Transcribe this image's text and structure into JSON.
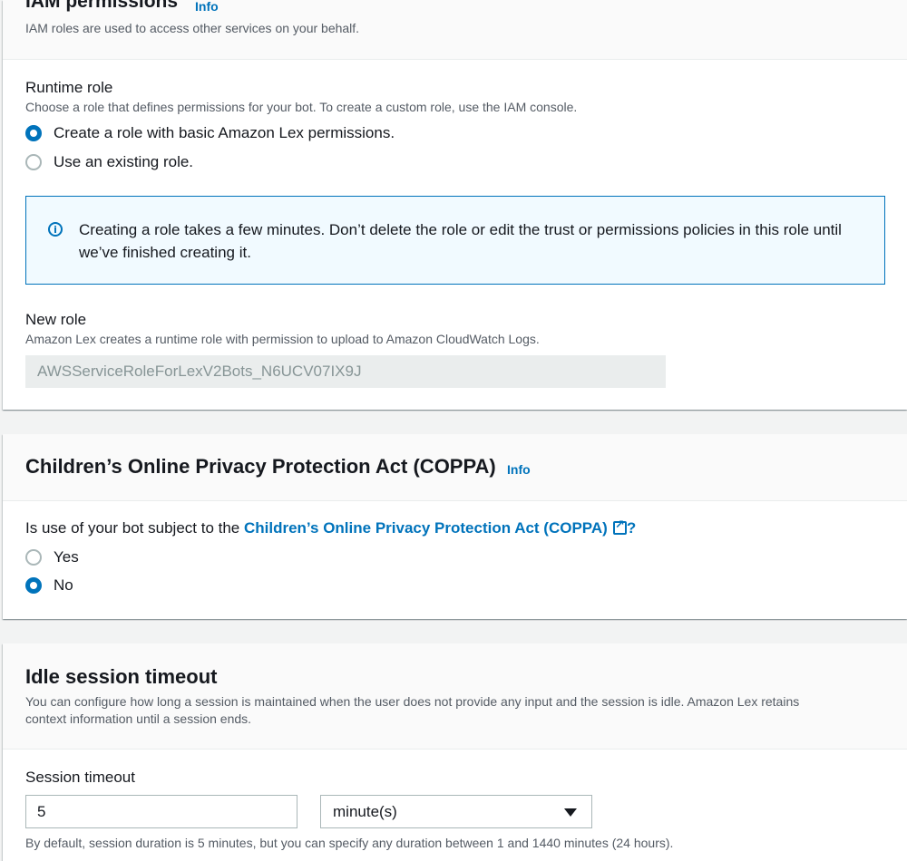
{
  "iam": {
    "title": "IAM permissions",
    "info": "Info",
    "description": "IAM roles are used to access other services on your behalf.",
    "runtime_role_label": "Runtime role",
    "runtime_role_help": "Choose a role that defines permissions for your bot. To create a custom role, use the IAM console.",
    "options": [
      {
        "label": "Create a role with basic Amazon Lex permissions.",
        "selected": true
      },
      {
        "label": "Use an existing role.",
        "selected": false
      }
    ],
    "alert_text": "Creating a role takes a few minutes. Don’t delete the role or edit the trust or permissions policies in this role until we’ve finished creating it.",
    "new_role_label": "New role",
    "new_role_help": "Amazon Lex creates a runtime role with permission to upload to Amazon CloudWatch Logs.",
    "new_role_value": "AWSServiceRoleForLexV2Bots_N6UCV07IX9J"
  },
  "coppa": {
    "title": "Children’s Online Privacy Protection Act (COPPA)",
    "info": "Info",
    "question_prefix": "Is use of your bot subject to the ",
    "question_link": "Children’s Online Privacy Protection Act (COPPA)",
    "question_suffix": "?",
    "options": [
      {
        "label": "Yes",
        "selected": false
      },
      {
        "label": "No",
        "selected": true
      }
    ]
  },
  "idle": {
    "title": "Idle session timeout",
    "description_line1": "You can configure how long a session is maintained when the user does not provide any input and the session is idle. Amazon Lex retains",
    "description_line2": "context information until a session ends.",
    "session_timeout_label": "Session timeout",
    "timeout_value": "5",
    "unit_selected": "minute(s)",
    "help": "By default, session duration is 5 minutes, but you can specify any duration between 1 and 1440 minutes (24 hours)."
  },
  "colors": {
    "accent": "#0073bb",
    "alert_bg": "#f1faff",
    "page_bg": "#f2f3f3"
  }
}
